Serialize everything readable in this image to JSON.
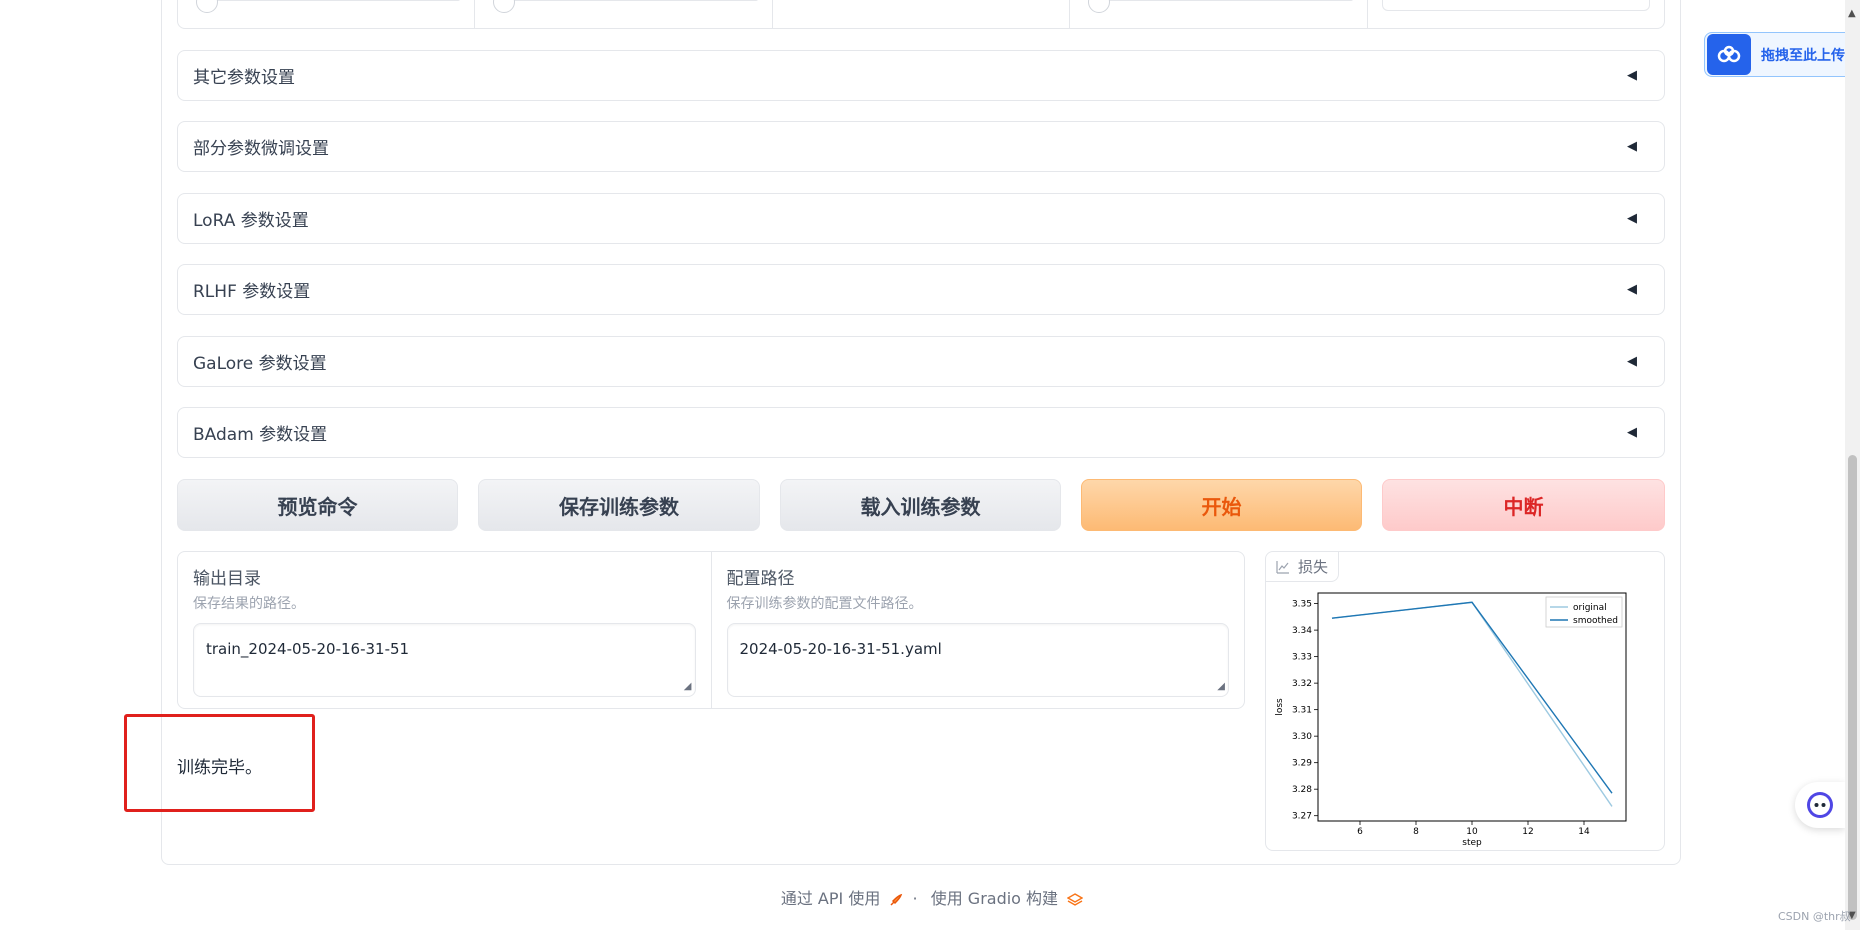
{
  "accordions": [
    {
      "label": "其它参数设置"
    },
    {
      "label": "部分参数微调设置"
    },
    {
      "label": "LoRA 参数设置"
    },
    {
      "label": "RLHF 参数设置"
    },
    {
      "label": "GaLore 参数设置"
    },
    {
      "label": "BAdam 参数设置"
    }
  ],
  "arrow_glyph": "◀",
  "buttons": {
    "preview": "预览命令",
    "save": "保存训练参数",
    "load": "载入训练参数",
    "start": "开始",
    "abort": "中断"
  },
  "output_dir": {
    "label": "输出目录",
    "info": "保存结果的路径。",
    "value": "train_2024-05-20-16-31-51"
  },
  "config_path": {
    "label": "配置路径",
    "info": "保存训练参数的配置文件路径。",
    "value": "2024-05-20-16-31-51.yaml"
  },
  "status": {
    "text": "训练完毕。"
  },
  "plot": {
    "tab_label": "损失"
  },
  "chart_data": {
    "type": "line",
    "xlabel": "step",
    "ylabel": "loss",
    "xlim": [
      4.5,
      15.5
    ],
    "ylim": [
      3.268,
      3.354
    ],
    "xticks": [
      6,
      8,
      10,
      12,
      14
    ],
    "yticks": [
      3.27,
      3.28,
      3.29,
      3.3,
      3.31,
      3.32,
      3.33,
      3.34,
      3.35
    ],
    "ytick_labels": [
      "3.27",
      "3.28",
      "3.29",
      "3.30",
      "3.31",
      "3.32",
      "3.33",
      "3.34",
      "3.35"
    ],
    "legend_position": "top-right",
    "series": [
      {
        "name": "original",
        "color": "#9ecae1",
        "x": [
          5,
          10,
          15
        ],
        "y": [
          3.3445,
          3.3505,
          3.2735
        ]
      },
      {
        "name": "smoothed",
        "color": "#1f77b4",
        "x": [
          5,
          10,
          15
        ],
        "y": [
          3.3445,
          3.3505,
          3.2785
        ]
      }
    ]
  },
  "footer": {
    "api": "通过 API 使用",
    "separator": "·",
    "built": "使用 Gradio 构建"
  },
  "upload_widget": {
    "label": "拖拽至此上传"
  },
  "watermark": "CSDN @thr叔"
}
